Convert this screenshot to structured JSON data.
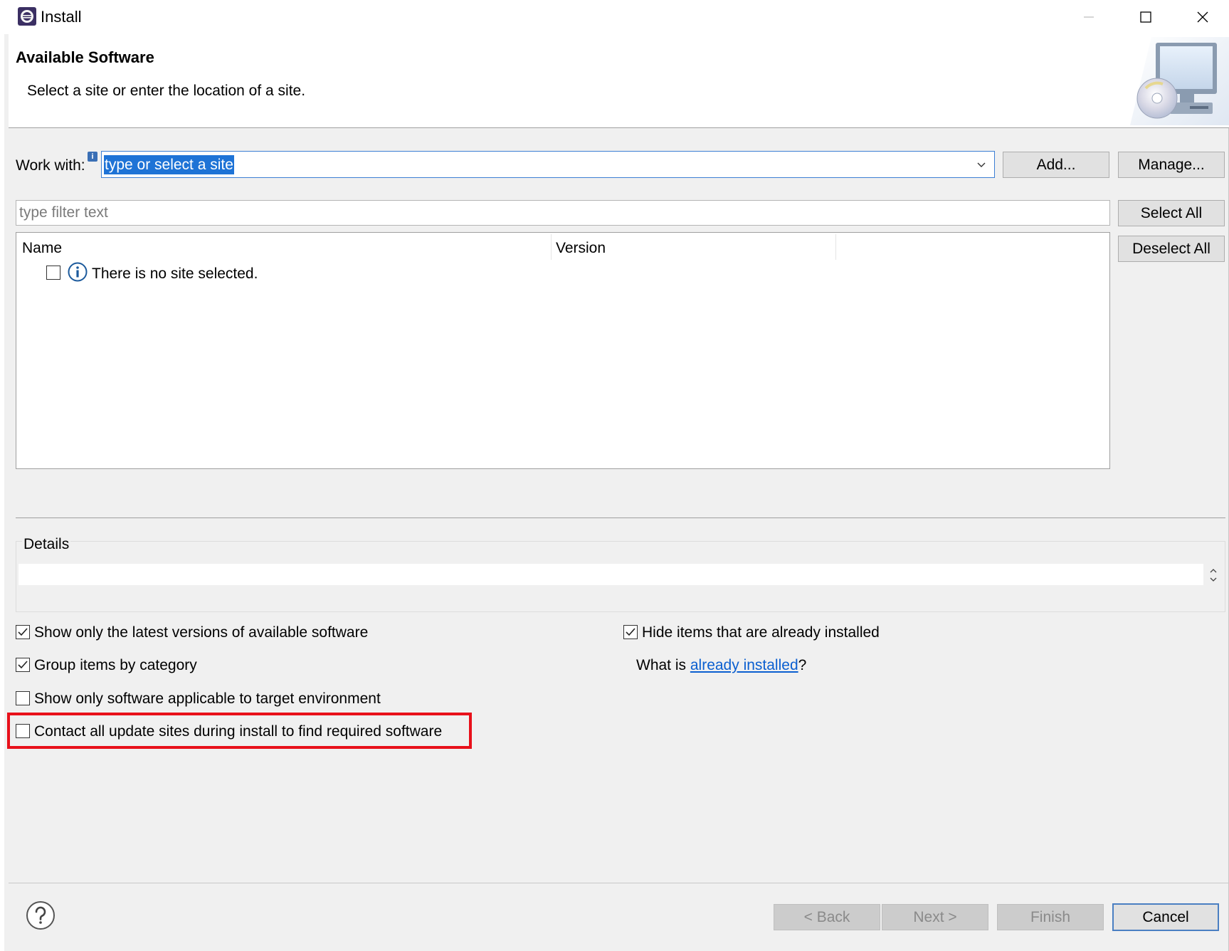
{
  "window": {
    "title": "Install",
    "app_icon": "eclipse-icon",
    "controls": [
      "minimize-icon",
      "maximize-icon",
      "close-icon"
    ]
  },
  "header": {
    "title": "Available Software",
    "description": "Select a site or enter the location of a site.",
    "art_icon": "monitor-cd-icon"
  },
  "work_with": {
    "label": "Work with:",
    "value": "type or select a site",
    "add_button": "Add...",
    "manage_button": "Manage..."
  },
  "filter": {
    "placeholder": "type filter text"
  },
  "selection_buttons": {
    "select_all": "Select All",
    "deselect_all": "Deselect All"
  },
  "table": {
    "columns": [
      "Name",
      "Version"
    ],
    "rows": [
      {
        "checked": false,
        "icon": "info-icon",
        "text": "There is no site selected."
      }
    ]
  },
  "details": {
    "label": "Details",
    "text": ""
  },
  "options": {
    "show_latest": {
      "label": "Show only the latest versions of available software",
      "checked": true
    },
    "group_by_category": {
      "label": "Group items by category",
      "checked": true
    },
    "show_applicable": {
      "label": "Show only software applicable to target environment",
      "checked": false
    },
    "contact_all_sites": {
      "label": "Contact all update sites during install to find required software",
      "checked": false
    },
    "hide_installed": {
      "label": "Hide items that are already installed",
      "checked": true
    },
    "what_is_prefix": "What is ",
    "what_is_link": "already installed",
    "what_is_suffix": "?"
  },
  "footer": {
    "back": "< Back",
    "next": "Next >",
    "finish": "Finish",
    "cancel": "Cancel",
    "help_icon": "help-icon"
  },
  "colors": {
    "highlight": "#e8101a",
    "selection": "#1e73d6",
    "link": "#0b5fd0"
  }
}
